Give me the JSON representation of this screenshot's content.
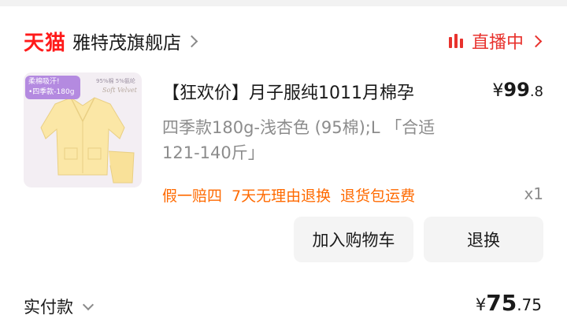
{
  "store": {
    "brand": "天猫",
    "name": "雅特茂旗舰店"
  },
  "live": {
    "label": "直播中"
  },
  "product": {
    "image_badge": [
      "柔棉吸汗!",
      "•四季款-180g"
    ],
    "image_spec": "95%棉 5%氨纶",
    "image_soft": "Soft Velvet",
    "title": "【狂欢价】月子服纯1011月棉孕",
    "price_symbol": "¥",
    "price_int": "99",
    "price_dec": ".8",
    "variant": "四季款180g-浅杏色 (95棉);L 「合适121-140斤」",
    "services": [
      "假一赔四",
      "7天无理由退换",
      "退货包运费"
    ],
    "quantity": "x1"
  },
  "actions": {
    "add_to_cart": "加入购物车",
    "return_exchange": "退换"
  },
  "payment": {
    "label": "实付款",
    "symbol": "¥",
    "amount_int": "75",
    "amount_dec": ".75"
  },
  "colors": {
    "brand_red": "#ff1a1a",
    "live_red": "#e8322d",
    "service_orange": "#ff6a00",
    "muted": "#8c8c8c",
    "button_bg": "#f4f4f4"
  }
}
